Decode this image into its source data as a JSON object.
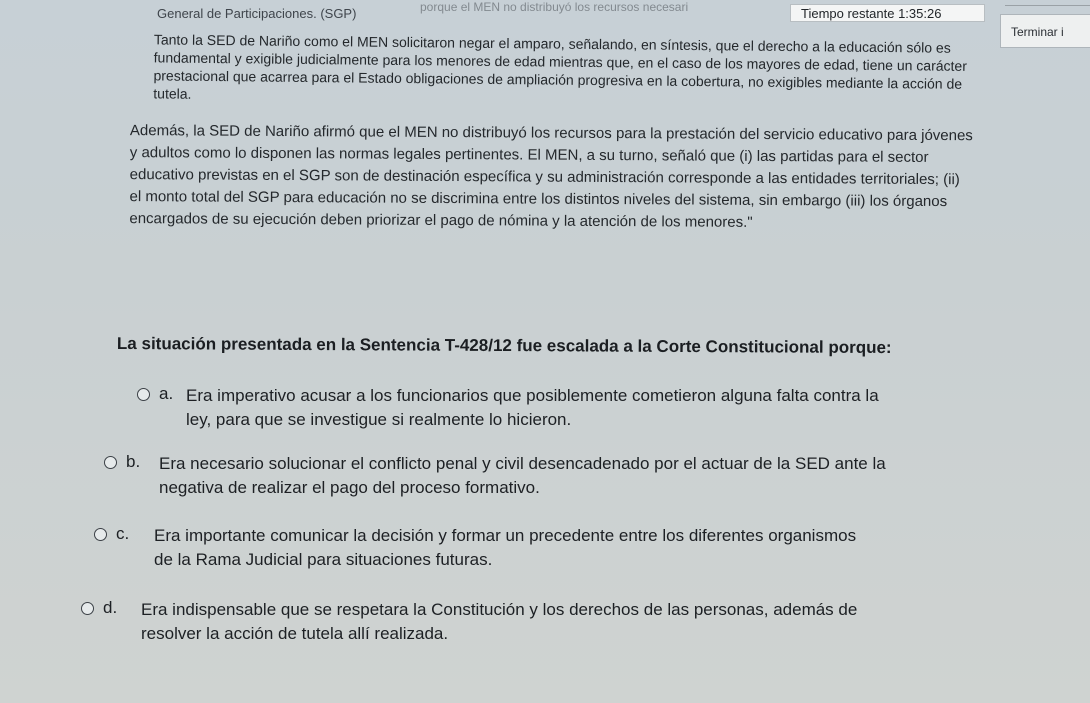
{
  "header": {
    "faded_text": "porque el MEN no distribuyó los recursos necesari",
    "context_label": "General de Participaciones. (SGP)",
    "timer_label": "Tiempo restante",
    "timer_value": "1:35:26",
    "finish_label": "Terminar i"
  },
  "passage": {
    "paragraph_1": "Tanto la SED de Nariño como el MEN solicitaron negar el amparo, señalando, en síntesis, que el derecho a la educación sólo es fundamental y exigible judicialmente para los menores de edad mientras que, en el caso de los mayores de edad, tiene un carácter prestacional que acarrea para el Estado obligaciones de ampliación progresiva en la cobertura, no exigibles mediante la acción de tutela.",
    "paragraph_2": "Además, la SED de Nariño afirmó que el MEN no distribuyó los recursos para la prestación del servicio educativo para jóvenes y adultos como lo disponen las normas legales pertinentes. El MEN, a su turno, señaló que (i) las partidas para el sector educativo previstas en el SGP son de destinación específica y su administración corresponde a las entidades territoriales; (ii) el monto total del SGP para educación no se discrimina entre los distintos niveles del sistema, sin embargo (iii) los órganos encargados de su ejecución deben priorizar el pago de nómina y la atención de los menores.\""
  },
  "question": {
    "stem": "La situación presentada en la Sentencia T-428/12 fue escalada a la Corte Constitucional porque:",
    "options": [
      {
        "letter": "a.",
        "line1": "Era imperativo acusar a los funcionarios que posiblemente cometieron alguna falta contra la",
        "line2": "ley, para que se investigue si realmente lo hicieron."
      },
      {
        "letter": "b.",
        "line1": "Era necesario solucionar el conflicto penal y civil desencadenado por el actuar de la SED ante la",
        "line2": "negativa de realizar el pago del proceso formativo."
      },
      {
        "letter": "c.",
        "line1": "Era importante comunicar la decisión y formar un precedente entre los diferentes organismos",
        "line2": "de la Rama Judicial para situaciones futuras."
      },
      {
        "letter": "d.",
        "line1": "Era indispensable que se respetara la Constitución y los derechos de las personas, además de",
        "line2": "resolver la acción de tutela allí realizada."
      }
    ]
  }
}
